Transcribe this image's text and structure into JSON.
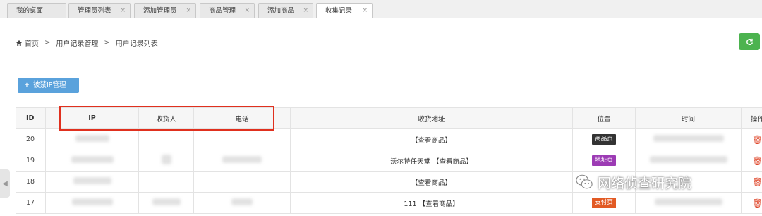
{
  "tabs": [
    {
      "label": "我的桌面",
      "closable": false,
      "active": false
    },
    {
      "label": "管理员列表",
      "closable": true,
      "active": false
    },
    {
      "label": "添加管理员",
      "closable": true,
      "active": false
    },
    {
      "label": "商品管理",
      "closable": true,
      "active": false
    },
    {
      "label": "添加商品",
      "closable": true,
      "active": false
    },
    {
      "label": "收集记录",
      "closable": true,
      "active": true
    }
  ],
  "tab_close_glyph": "×",
  "breadcrumb": {
    "home": "首页",
    "sep": ">",
    "level1": "用户记录管理",
    "level2": "用户记录列表"
  },
  "toolbar": {
    "ban_ip_label": "被禁IP管理",
    "plus": "+"
  },
  "table": {
    "headers": {
      "id": "ID",
      "ip": "IP",
      "receiver": "收货人",
      "phone": "电话",
      "address": "收货地址",
      "position": "位置",
      "time": "时间",
      "ops": "操作"
    },
    "rows": [
      {
        "id": "20",
        "address": "【查看商品】",
        "position": "商品页",
        "position_color": "#333333"
      },
      {
        "id": "19",
        "address": "沃尔特任天堂 【查看商品】",
        "position": "地址页",
        "position_color": "#9c3bb4"
      },
      {
        "id": "18",
        "address": "【查看商品】",
        "position": "",
        "position_color": "#333333"
      },
      {
        "id": "17",
        "address": "111 【查看商品】",
        "position": "支付页",
        "position_color": "#e25a24"
      }
    ]
  },
  "watermark": "网络侦查研究院",
  "colors": {
    "refresh": "#4cb34f",
    "ban_button": "#5aa2dc",
    "highlight_box": "#e0301e",
    "delete": "#e04a2e"
  },
  "icons": {
    "home": "home-icon",
    "refresh": "refresh-icon",
    "delete": "trash-icon",
    "collapse": "chevron-left-icon",
    "watermark": "wechat-logo-icon"
  }
}
